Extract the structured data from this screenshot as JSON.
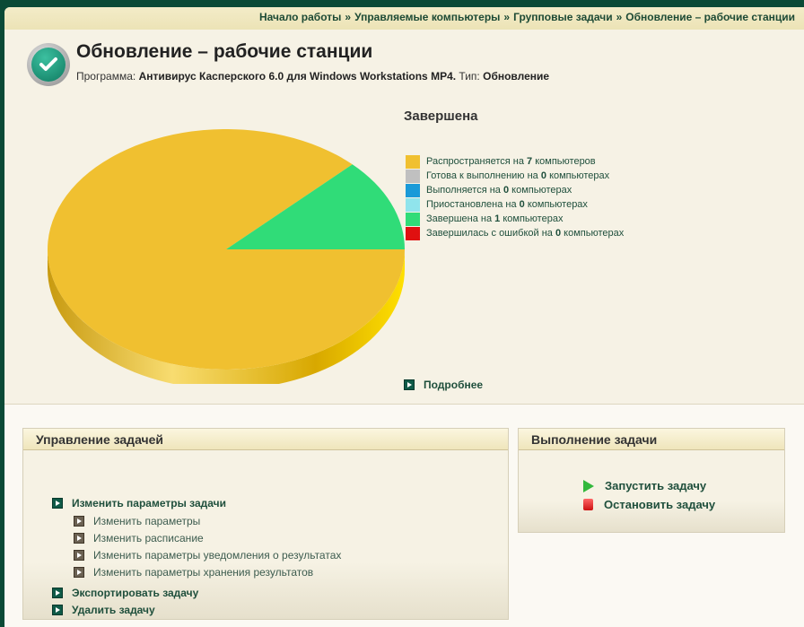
{
  "breadcrumb": [
    "Начало работы",
    "Управляемые компьютеры",
    "Групповые задачи",
    "Обновление – рабочие станции"
  ],
  "breadcrumb_separator": "»",
  "header": {
    "title": "Обновление – рабочие станции",
    "program_label": "Программа:",
    "program": "Антивирус Касперского 6.0 для Windows Workstations MP4.",
    "type_label": "Тип:",
    "type": "Обновление",
    "icon": "check-circle-icon"
  },
  "status": "Завершена",
  "chart_data": {
    "type": "pie",
    "style": "3d",
    "slices": [
      {
        "pre": "Распространяется на",
        "value": 7,
        "post": "компьютеров",
        "color": "#f0c030"
      },
      {
        "pre": "Готова к выполнению на",
        "value": 0,
        "post": "компьютерах",
        "color": "#c0c0c0"
      },
      {
        "pre": "Выполняется на",
        "value": 0,
        "post": "компьютерах",
        "color": "#1a9ad8"
      },
      {
        "pre": "Приостановлена на",
        "value": 0,
        "post": "компьютерах",
        "color": "#90e4ec"
      },
      {
        "pre": "Завершена на",
        "value": 1,
        "post": "компьютерах",
        "color": "#30dc78"
      },
      {
        "pre": "Завершилась с ошибкой на",
        "value": 0,
        "post": "компьютерах",
        "color": "#e01010"
      }
    ],
    "legend_position": "right"
  },
  "more_link": "Подробнее",
  "task_mgmt": {
    "title": "Управление задачей",
    "edit": "Изменить параметры задачи",
    "sub": [
      "Изменить параметры",
      "Изменить расписание",
      "Изменить параметры уведомления о результатах",
      "Изменить параметры хранения результатов"
    ],
    "export": "Экспортировать задачу",
    "delete": "Удалить задачу"
  },
  "task_run": {
    "title": "Выполнение задачи",
    "start": "Запустить задачу",
    "stop": "Остановить задачу"
  }
}
